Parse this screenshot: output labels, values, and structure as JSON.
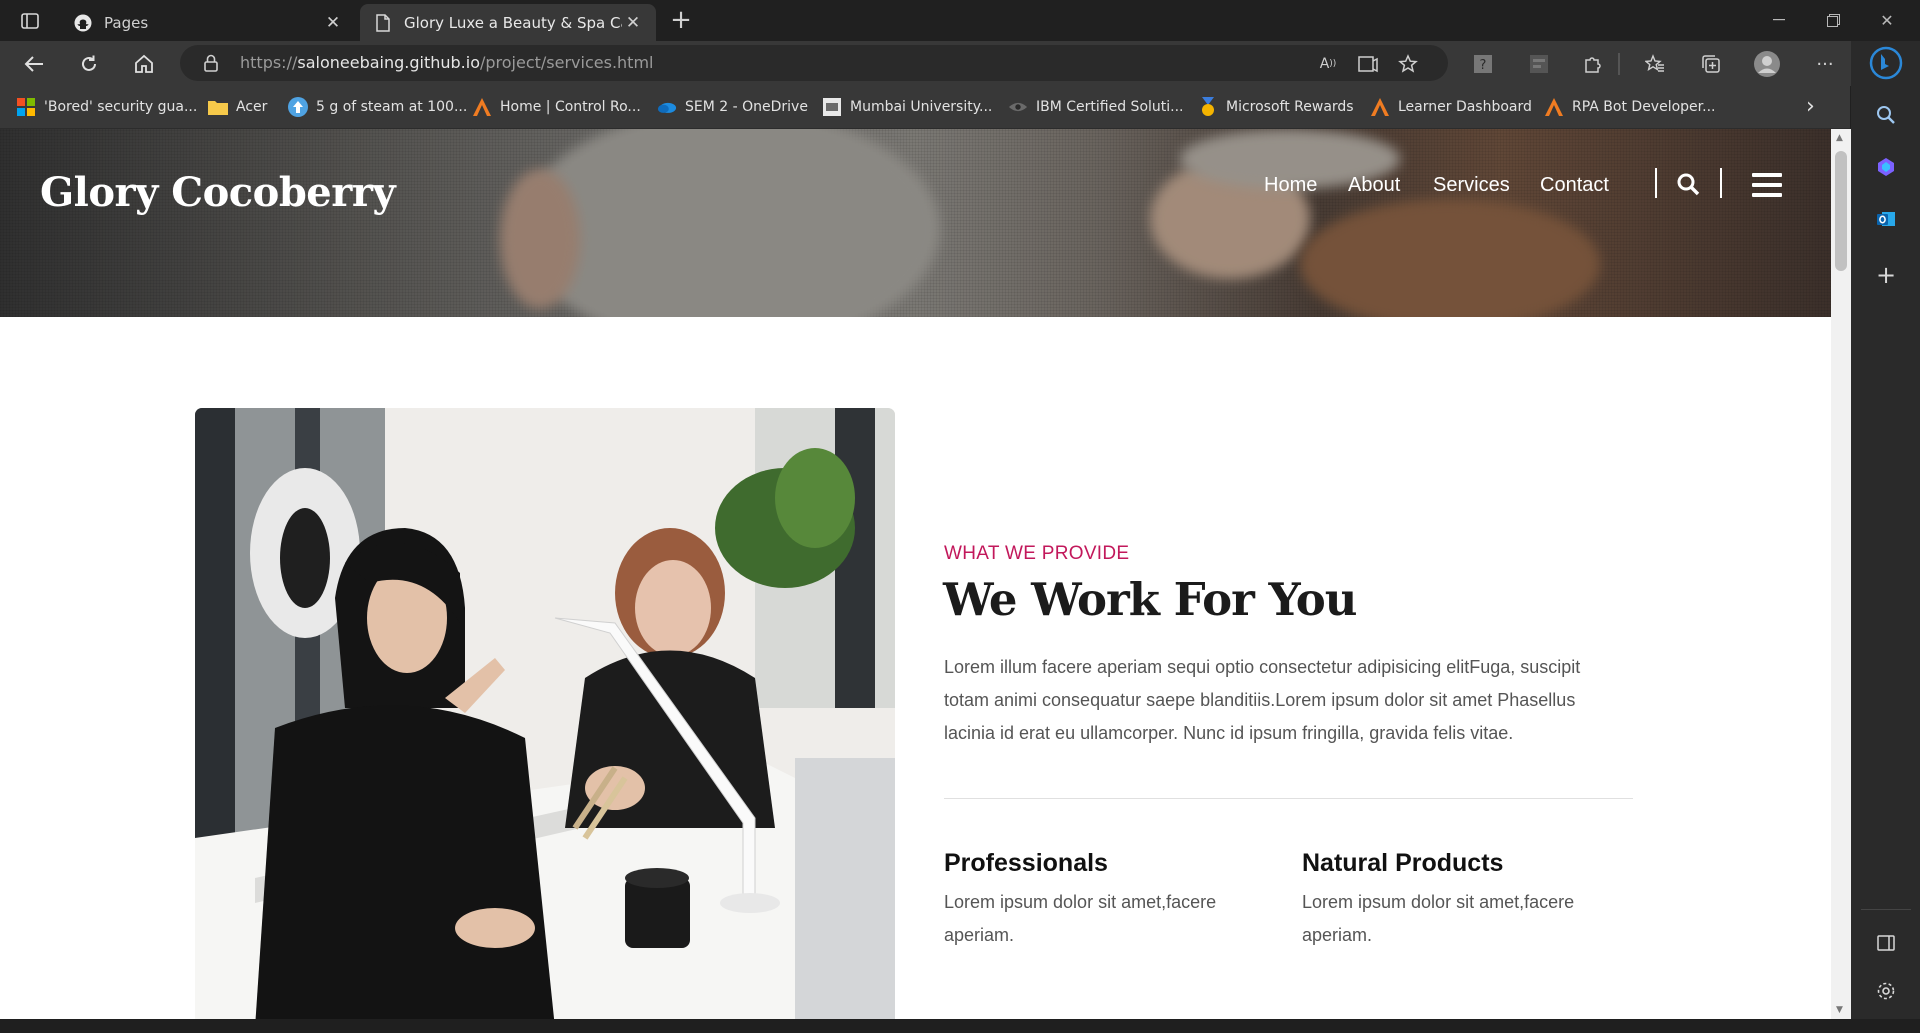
{
  "browser": {
    "tabs": [
      {
        "title": "Pages",
        "icon": "github-icon",
        "active": false
      },
      {
        "title": "Glory Luxe a Beauty & Spa Categ",
        "icon": "page-icon",
        "active": true
      }
    ],
    "url_scheme": "https://",
    "url_host": "saloneebaing.github.io",
    "url_path": "/project/services.html",
    "bookmarks": [
      {
        "label": "'Bored' security gua...",
        "icon": "microsoft-icon"
      },
      {
        "label": "Acer",
        "icon": "folder-icon"
      },
      {
        "label": "5 g of steam at 100...",
        "icon": "upload-icon"
      },
      {
        "label": "Home | Control Ro...",
        "icon": "triangle-logo-icon"
      },
      {
        "label": "SEM 2 - OneDrive",
        "icon": "onedrive-icon"
      },
      {
        "label": "Mumbai University...",
        "icon": "university-icon"
      },
      {
        "label": "IBM Certified Soluti...",
        "icon": "ibm-icon"
      },
      {
        "label": "Microsoft Rewards",
        "icon": "medal-icon"
      },
      {
        "label": "Learner Dashboard",
        "icon": "triangle-logo-icon"
      },
      {
        "label": "RPA Bot Developer...",
        "icon": "triangle-logo-icon"
      }
    ]
  },
  "site": {
    "logo": "Glory Cocoberry",
    "nav": [
      "Home",
      "About",
      "Services",
      "Contact"
    ]
  },
  "content": {
    "eyebrow": "WHAT WE PROVIDE",
    "headline": "We Work For You",
    "para_lines": [
      "Lorem illum facere aperiam sequi optio consectetur adipisicing elitFuga, suscipit",
      "totam animi consequatur saepe blanditiis.Lorem ipsum dolor sit amet Phasellus",
      "lacinia id erat eu ullamcorper. Nunc id ipsum fringilla, gravida felis vitae."
    ],
    "features": [
      {
        "title": "Professionals",
        "lines": [
          "Lorem ipsum dolor sit amet,facere",
          "aperiam."
        ]
      },
      {
        "title": "Natural Products",
        "lines": [
          "Lorem ipsum dolor sit amet,facere",
          "aperiam."
        ]
      }
    ]
  },
  "colors": {
    "accent": "#c2185b",
    "chrome_dark": "#202020",
    "chrome_toolbar": "#383838"
  }
}
